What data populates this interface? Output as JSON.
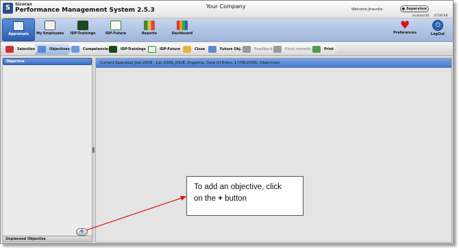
{
  "title_bar": {
    "brand": "Sicorax",
    "system_name": "Performance Management System 2.5.3",
    "company": "Your Company",
    "welcome": "Welcome jtravolta",
    "role_button": "Supervisor",
    "server": "localhost:80",
    "memory": "97560 KB"
  },
  "main_toolbar": [
    {
      "label": "Appraisals",
      "icon": "appraisals-icon",
      "active": true
    },
    {
      "label": "My Employees",
      "icon": "employees-icon",
      "active": false
    },
    {
      "label": "IDP-Trainings",
      "icon": "trainings-icon",
      "active": false
    },
    {
      "label": "IDP-Future",
      "icon": "future-icon",
      "active": false
    },
    {
      "label": "Reports",
      "icon": "reports-icon",
      "active": false
    },
    {
      "label": "Dashboard",
      "icon": "dashboard-icon",
      "active": false
    },
    {
      "label": "Preferences",
      "icon": "heart-icon",
      "active": false
    },
    {
      "label": "LogOut",
      "icon": "power-icon",
      "active": false
    }
  ],
  "step_tabs": [
    {
      "label": "Selection",
      "state": "normal"
    },
    {
      "label": "Objectives",
      "state": "active"
    },
    {
      "label": "Competencies",
      "state": "normal"
    },
    {
      "label": "IDP-Trainings",
      "state": "normal"
    },
    {
      "label": "IDP-Future",
      "state": "normal"
    },
    {
      "label": "Close",
      "state": "normal"
    },
    {
      "label": "Future Obj.",
      "state": "normal"
    },
    {
      "label": "Feedback",
      "state": "disabled"
    },
    {
      "label": "Final remarks",
      "state": "disabled"
    },
    {
      "label": "Print",
      "state": "normal"
    }
  ],
  "left_panel": {
    "header": "Objective",
    "footer": "Unplanned Objective",
    "add_button": "+"
  },
  "right_panel": {
    "header": "Current Appraisal (Jan-2009 - Jun-2009, JOLIE, Angelina, Date Of Entry: 17/08/2009): Objectives"
  },
  "callout": {
    "line1": "To add an objective, click",
    "line2_prefix": "on the ",
    "line2_plus": "+",
    "line2_suffix": " button"
  },
  "colors": {
    "accent": "#3a6cc2",
    "arrow": "#e01010"
  }
}
